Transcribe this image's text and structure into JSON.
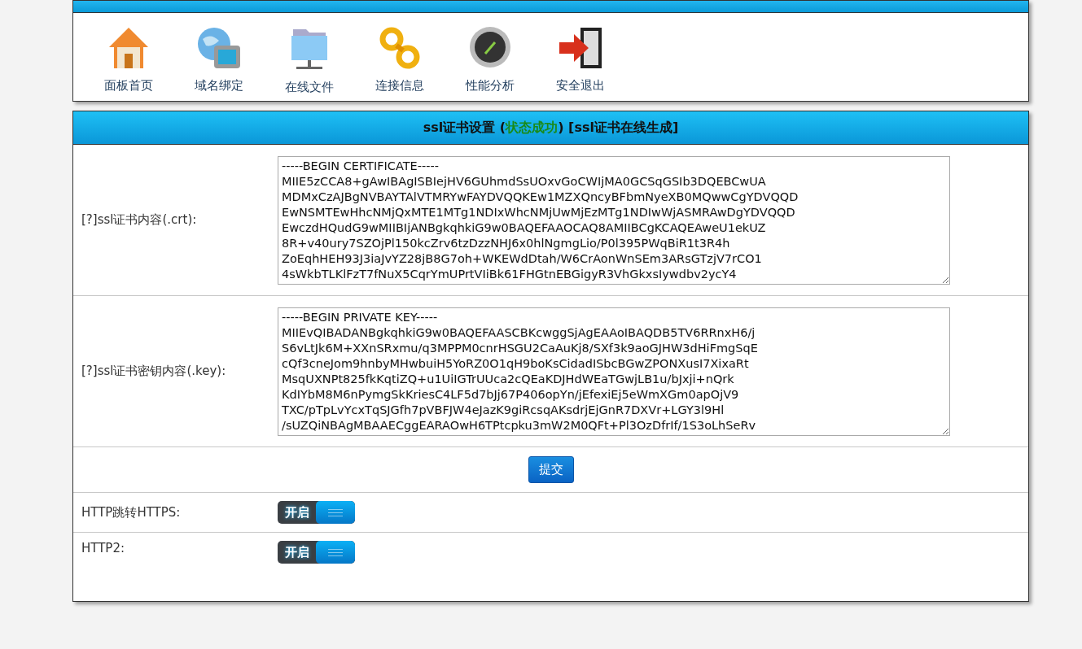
{
  "toolbar": [
    {
      "label": "面板首页"
    },
    {
      "label": "域名绑定"
    },
    {
      "label": "在线文件"
    },
    {
      "label": "连接信息"
    },
    {
      "label": "性能分析"
    },
    {
      "label": "安全退出"
    }
  ],
  "ssl_panel": {
    "title": "ssl证书设置 (",
    "status": "状态成功",
    "title_end": ") [ssl证书在线生成]",
    "fields": [
      {
        "label": "[?]ssl证书内容(.crt):",
        "value": "-----BEGIN CERTIFICATE-----\nMIIE5zCCA8+gAwIBAgISBIejHV6GUhmdSsUOxvGoCWIjMA0GCSqGSIb3DQEBCwUA\nMDMxCzAJBgNVBAYTAlVTMRYwFAYDVQQKEw1MZXQncyBFbmNyeXB0MQwwCgYDVQQD\nEwNSMTEwHhcNMjQxMTE1MTg1NDIxWhcNMjUwMjEzMTg1NDIwWjASMRAwDgYDVQQD\nEwczdHQudG9wMIIBIjANBgkqhkiG9w0BAQEFAAOCAQ8AMIIBCgKCAQEAweU1ekUZ\n8R+v40ury7SZOjPl150kcZrv6tzDzzNHJ6x0hlNgmgLio/P0l395PWqBiR1t3R4h\nZoEqhHEH93J3iaJvYZ28jB8G7oh+WKEWdDtah/W6CrAonWnSEm3ARsGTzjV7rCO1\n4sWkbTLKlFzT7fNuX5CqrYmUPrtVIiBk61FHGtnEBGigyR3VhGkxsIywdbv2ycY4"
      },
      {
        "label": "[?]ssl证书密钥内容(.key):",
        "value": "-----BEGIN PRIVATE KEY-----\nMIIEvQIBADANBgkqhkiG9w0BAQEFAASCBKcwggSjAgEAAoIBAQDB5TV6RRnxH6/j\nS6vLtJk6M+XXnSRxmu/q3MPPM0cnrHSGU2CaAuKj8/SXf3k9aoGJHW3dHiFmgSqE\ncQf3cneJom9hnbyMHwbuiH5YoRZ0O1qH9boKsCidadISbcBGwZPONXusI7XixaRt\nMsqUXNPt825fkKqtiZQ+u1UiIGTrUUca2cQEaKDJHdWEaTGwjLB1u/bJxji+nQrk\nKdIYbM8M6nPymgSkKriesC4LF5d7bJj67P406opYn/jEfexiEj5eWmXGm0apOjV9\nTXC/pTpLvYcxTqSJGfh7pVBFJW4eJazK9giRcsqAKsdrjEjGnR7DXVr+LGY3l9Hl\n/sUZQiNBAgMBAAECggEARAOwH6TPtcpku3mW2M0QFt+Pl3OzDfrIf/1S3oLhSeRv"
      }
    ],
    "submit": "提交",
    "toggles": [
      {
        "label": "HTTP跳转HTTPS:",
        "text": "开启",
        "on": true
      },
      {
        "label": "HTTP2:",
        "text": "开启",
        "on": true
      }
    ]
  }
}
